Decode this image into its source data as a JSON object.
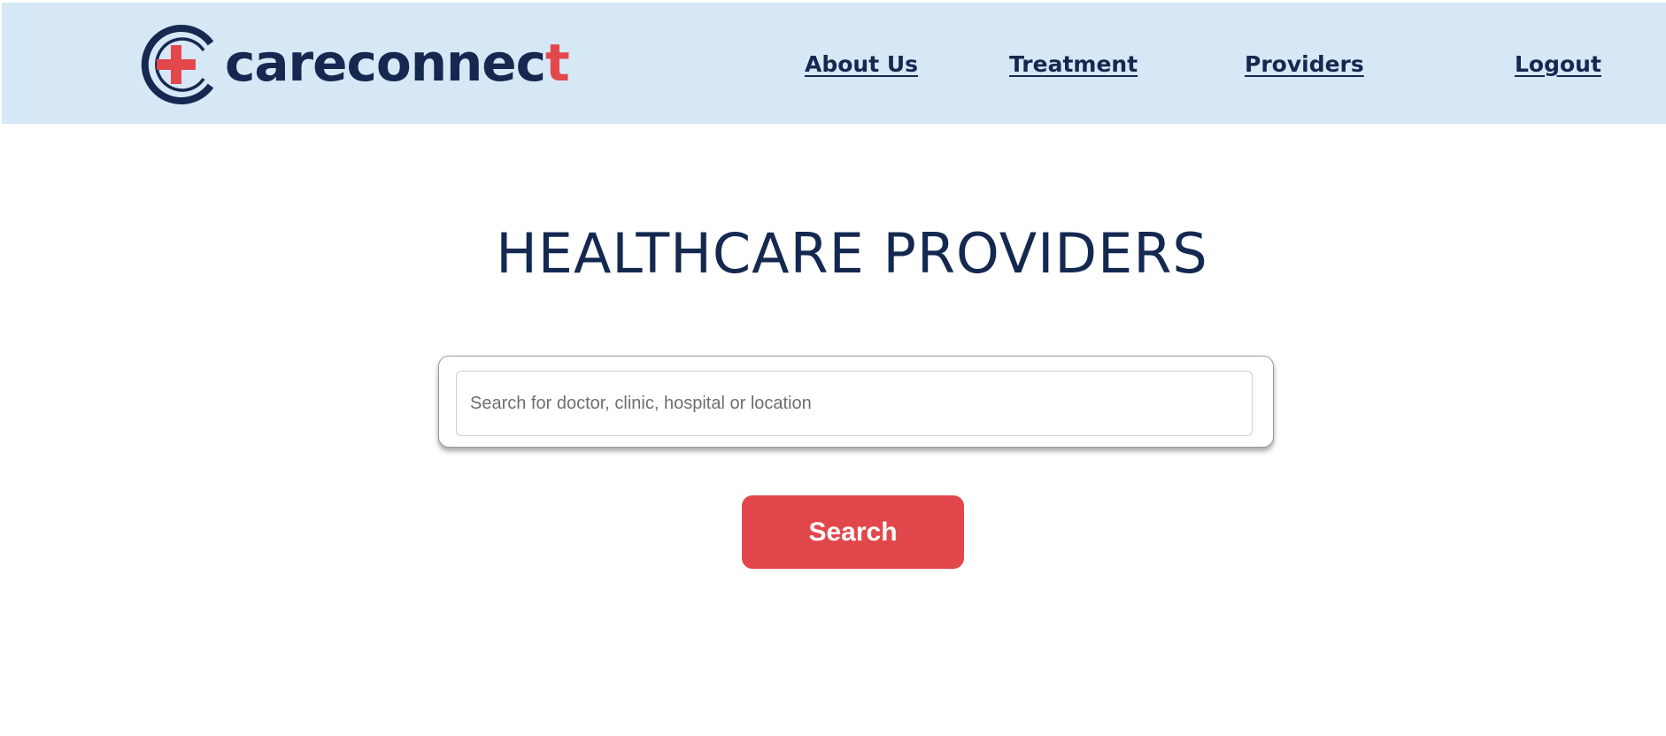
{
  "brand": {
    "name_main": "careconnec",
    "name_accent": "t",
    "colors": {
      "navy": "#142850",
      "red": "#e2474c",
      "header_bg": "#d6e8f5"
    },
    "icon": "cross-in-c-icon"
  },
  "nav": {
    "items": [
      {
        "label": "About Us"
      },
      {
        "label": "Treatment"
      },
      {
        "label": "Providers"
      },
      {
        "label": "Logout"
      }
    ]
  },
  "main": {
    "title": "HEALTHCARE PROVIDERS",
    "search": {
      "placeholder": "Search for doctor, clinic, hospital or location",
      "value": ""
    },
    "search_button_label": "Search"
  }
}
